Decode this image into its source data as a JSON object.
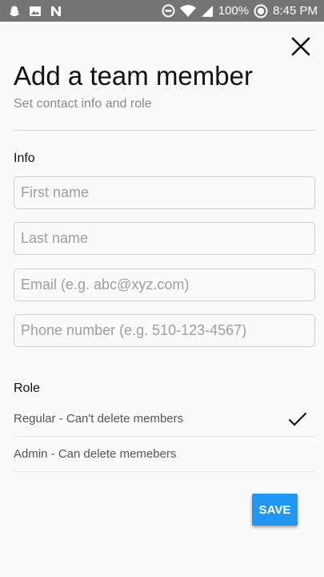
{
  "status_bar": {
    "left_icons": [
      "snapchat-icon",
      "image-icon",
      "n-app-icon"
    ],
    "battery": "100%",
    "time": "8:45 PM"
  },
  "dialog": {
    "close_icon": "close-icon",
    "title": "Add a team member",
    "subtitle": "Set contact info and role"
  },
  "info": {
    "label": "Info",
    "fields": [
      {
        "placeholder": "First name",
        "value": ""
      },
      {
        "placeholder": "Last name",
        "value": ""
      },
      {
        "placeholder": "Email (e.g. abc@xyz.com)",
        "value": ""
      },
      {
        "placeholder": "Phone number (e.g. 510-123-4567)",
        "value": ""
      }
    ]
  },
  "role": {
    "label": "Role",
    "options": [
      {
        "label": "Regular - Can't delete members",
        "selected": true
      },
      {
        "label": "Admin - Can delete memebers",
        "selected": false
      }
    ]
  },
  "actions": {
    "save_label": "SAVE"
  },
  "colors": {
    "accent": "#2196f3",
    "status_bar": "#757575"
  }
}
